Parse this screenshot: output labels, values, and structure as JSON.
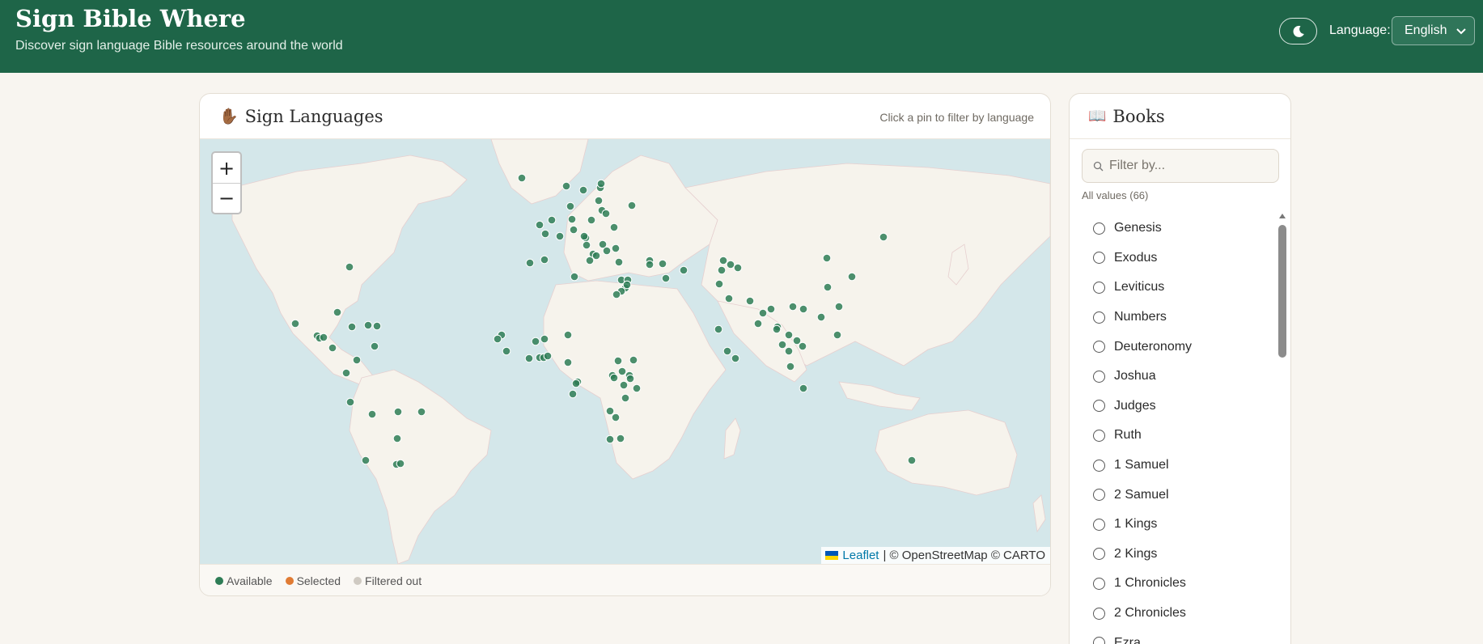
{
  "header": {
    "title": "Sign Bible Where",
    "subtitle": "Discover sign language Bible resources around the world",
    "language_label": "Language:",
    "language_value": "English",
    "theme_icon": "moon-icon"
  },
  "map_panel": {
    "icon": "✋🏾",
    "title": "Sign Languages",
    "hint": "Click a pin to filter by language",
    "zoom_in": "+",
    "zoom_out": "−",
    "attribution_link": "Leaflet",
    "attribution_text": "| © OpenStreetMap © CARTO",
    "legend": [
      {
        "label": "Available",
        "color": "#2e7d56"
      },
      {
        "label": "Selected",
        "color": "#e07b33"
      },
      {
        "label": "Filtered out",
        "color": "#cfcac2"
      }
    ],
    "colors": {
      "water": "#d4e7ea",
      "land": "#f6f3ec",
      "pin": "#2e7d56"
    }
  },
  "books_panel": {
    "icon": "📖",
    "title": "Books",
    "filter_placeholder": "Filter by...",
    "count_text": "All values (66)",
    "items": [
      "Genesis",
      "Exodus",
      "Leviticus",
      "Numbers",
      "Deuteronomy",
      "Joshua",
      "Judges",
      "Ruth",
      "1 Samuel",
      "2 Samuel",
      "1 Kings",
      "2 Kings",
      "1 Chronicles",
      "2 Chronicles",
      "Ezra"
    ]
  }
}
